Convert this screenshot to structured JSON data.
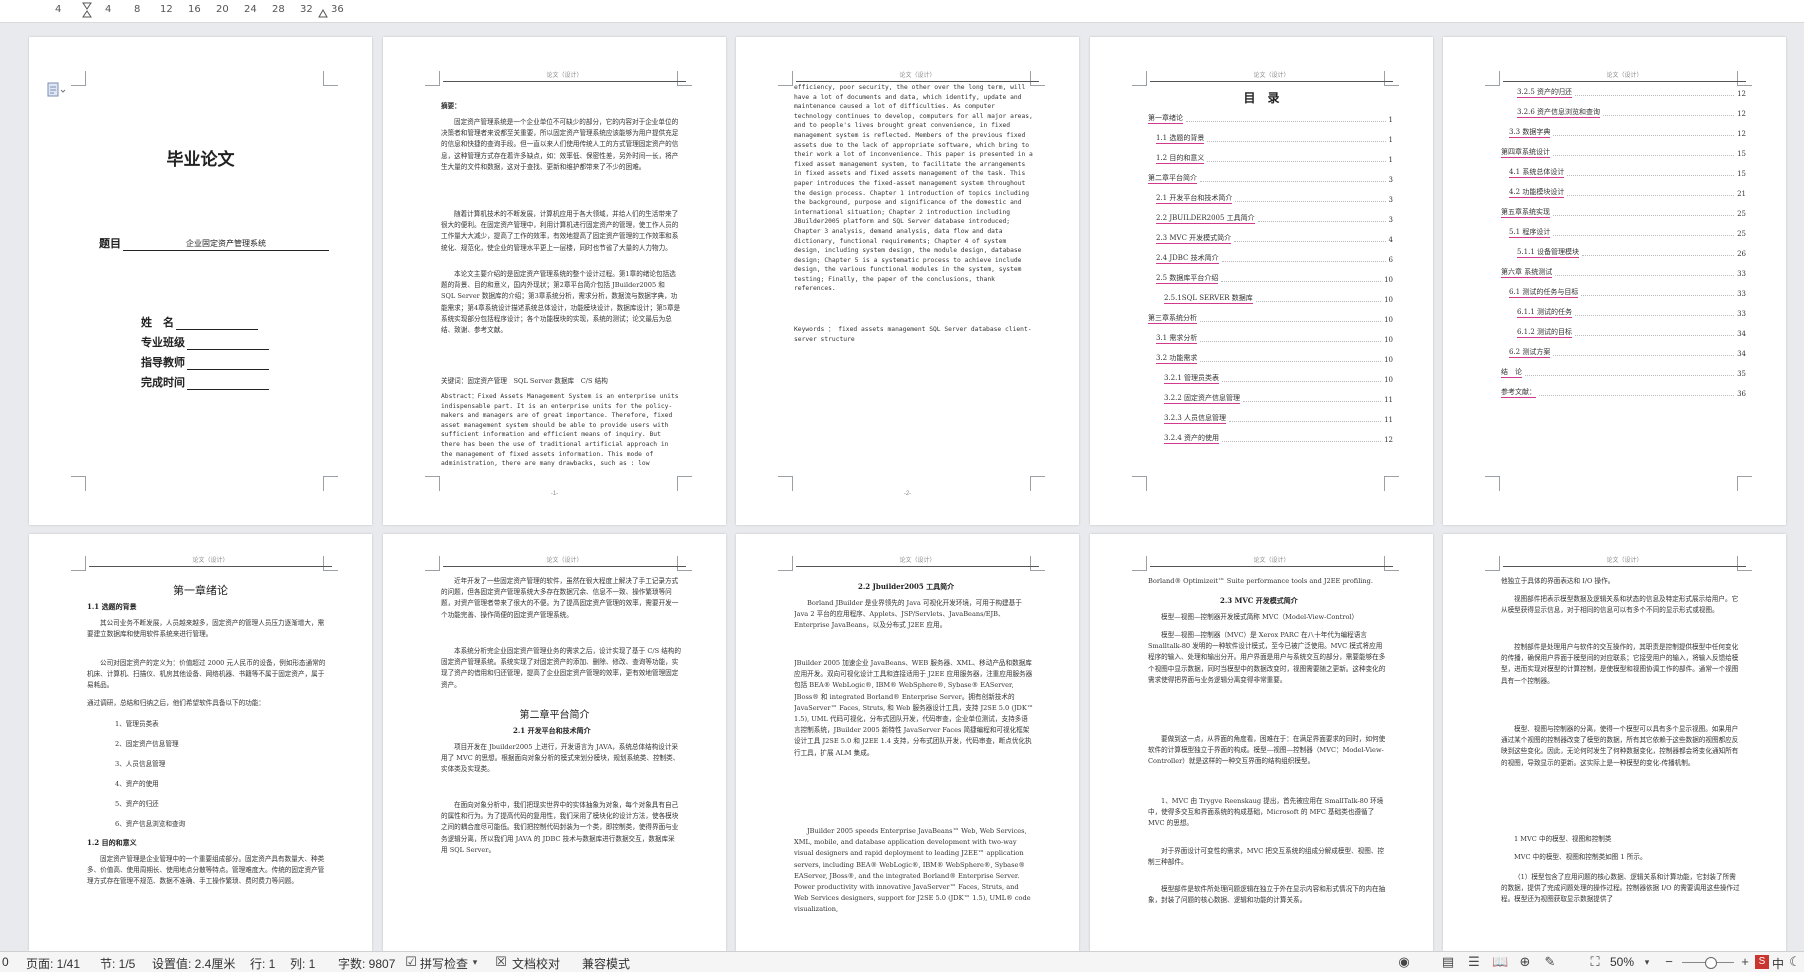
{
  "ruler": {
    "ticks": [
      "4",
      "4",
      "8",
      "12",
      "16",
      "20",
      "24",
      "28",
      "32",
      "36"
    ]
  },
  "pages": {
    "cover": {
      "title": "毕业论文",
      "topic_label": "题目",
      "topic_value": "企业固定资产管理系统",
      "fields": [
        "姓　名",
        "专业班级",
        "指导教师",
        "完成时间"
      ]
    },
    "abstract_cn": {
      "header": "论文（设计）",
      "heading": "摘要：",
      "p1": "固定资产管理系统是一个企业单位不可缺少的部分，它的内容对于企业单位的决策者和管理者来说都至关重要，所以固定资产管理系统应该能够为用户提供充足的信息和快捷的查询手段。但一直以来人们使用传统人工的方式管理固定资产的信息，这种管理方式存在着许多缺点，如：效率低、保密性差，另外时间一长，将产生大量的文件和数据，这对于查找、更新和维护都带来了不少的困难。",
      "p2": "随着计算机技术的不断发展，计算机应用于各大领域，并给人们的生活带来了很大的便利。在固定资产管理中，利用计算机进行固定资产的管理，使工作人员的工作量大大减少，提高了工作的效率，有效地提高了固定资产管理的工作效率和系统化、规范化，使企业的管理水平更上一层楼，同时也节省了大量的人力物力。",
      "p3": "本论文主要介绍的是固定资产管理系统的整个设计过程。第1章的绪论包括选题的背景、目的和意义，国内外现状；第2章平台简介包括 JBuilder2005 和 SQL Server 数据库的介绍；第3章系统分析，需求分析，数据流与数据字典，功能需求；第4章系统设计描述系统总体设计，功能模块设计，数据库设计；第5章是系统实现部分包括程序设计；各个功能模块的实现，系统的测试；论文最后为总结、致谢、参考文献。",
      "keywords": "关键词：固定资产管理　SQL Server 数据库　C/S 结构",
      "abstract_en": "Abstract：Fixed Assets Management System is an enterprise units indispensable part. It is an enterprise units for the policy-makers and managers are of great importance. Therefore, fixed asset management system should be able to provide users with sufficient information and efficient means of inquiry. But there has been the use of traditional artificial approach in the management of fixed assets information. This mode of administration, there are many drawbacks, such as : low",
      "footer": "-1-"
    },
    "abstract_en": {
      "header": "论文（设计）",
      "text": "efficiency, poor security, the other over the long term, will have a lot of documents and data, which identify, update and maintenance caused a lot of difficulties. As computer technology continues to develop, computers for all major areas, and to people's lives brought great convenience, in fixed management system is reflected. Members of the previous fixed assets due to the lack of appropriate software, which bring to their work a lot of inconvenience. This paper is presented in a fixed asset management system, to facilitate the arrangements in fixed assets and fixed assets management of the task. This paper introduces the fixed-asset management system throughout the design process. Chapter 1 introduction of topics including the background, purpose and significance of the domestic and international situation; Chapter 2 introduction including JBuilder2005 platform and SQL Server database introduced; Chapter 3 analysis, demand analysis, data flow and data dictionary, functional requirements; Chapter 4 of system design, including system design, the module design, database design; Chapter 5 is a systematic process to achieve include design, the various functional modules in the system, system testing; Finally, the paper of the conclusions, thank references.",
      "keywords": "Keywords ： fixed assets management SQL Server database client-server structure",
      "footer": "-2-"
    },
    "toc1": {
      "header": "论文（设计）",
      "title": "目　录",
      "items": [
        {
          "label": "第一章绪论",
          "page": "1"
        },
        {
          "label": "1.1 选题的背景",
          "page": "1"
        },
        {
          "label": "1.2 目的和意义",
          "page": "1"
        },
        {
          "label": "第二章平台简介",
          "page": "3"
        },
        {
          "label": "2.1 开发平台和技术简介",
          "page": "3"
        },
        {
          "label": "2.2 JBUILDER2005 工具简介",
          "page": "3"
        },
        {
          "label": "2.3 MVC 开发模式简介",
          "page": "4"
        },
        {
          "label": "2.4 JDBC 技术简介",
          "page": "6"
        },
        {
          "label": "2.5 数据库平台介绍",
          "page": "10"
        },
        {
          "label": "2.5.1SQL SERVER 数据库",
          "page": "10"
        },
        {
          "label": "第三章系统分析",
          "page": "10"
        },
        {
          "label": "3.1 需求分析",
          "page": "10"
        },
        {
          "label": "3.2 功能需求",
          "page": "10"
        },
        {
          "label": "3.2.1 管理员类表",
          "page": "10"
        },
        {
          "label": "3.2.2 固定资产信息管理",
          "page": "11"
        },
        {
          "label": "3.2.3 人员信息管理",
          "page": "11"
        },
        {
          "label": "3.2.4 资产的使用",
          "page": "12"
        }
      ]
    },
    "toc2": {
      "header": "论文（设计）",
      "items": [
        {
          "label": "3.2.5 资产的归还",
          "page": "12"
        },
        {
          "label": "3.2.6 资产信息浏览和查询",
          "page": "12"
        },
        {
          "label": "3.3 数据字典",
          "page": "12"
        },
        {
          "label": "第四章系统设计",
          "page": "15"
        },
        {
          "label": "4.1 系统总体设计",
          "page": "15"
        },
        {
          "label": "4.2 功能模块设计",
          "page": "21"
        },
        {
          "label": "第五章系统实现",
          "page": "25"
        },
        {
          "label": "5.1 程序设计",
          "page": "25"
        },
        {
          "label": "5.1.1 设备管理模块",
          "page": "26"
        },
        {
          "label": "第六章 系统测试",
          "page": "33"
        },
        {
          "label": "6.1 测试的任务与目标",
          "page": "33"
        },
        {
          "label": "6.1.1 测试的任务",
          "page": "33"
        },
        {
          "label": "6.1.2 测试的目标",
          "page": "34"
        },
        {
          "label": "6.2 测试方案",
          "page": "34"
        },
        {
          "label": "结　论",
          "page": "35"
        },
        {
          "label": "参考文献：",
          "page": "36"
        }
      ]
    },
    "ch1": {
      "header": "论文（设计）",
      "title": "第一章绪论",
      "s1": "1.1 选题的背景",
      "p1": "其公司业务不断发展，人员越来越多，固定资产的管理人员压力逐渐增大，需要建立数据库和使用软件系统来进行管理。",
      "p2": "公司对固定资产的定义为：价值超过 2000 元人民币的设备，例如形态通常的机床、计算机、扫描仪、机房其他设备、网络机器、书籍等不属于固定资产，属于易耗品。",
      "p3": "通过调研，总结和归纳之后，他们希望软件具备以下的功能：",
      "list": [
        "1、管理员类表",
        "2、固定资产信息管理",
        "3、人员信息管理",
        "4、资产的使用",
        "5、资产的归还",
        "6、资产信息浏览和查询"
      ],
      "s2": "1.2 目的和意义",
      "p4": "固定资产管理是企业管理中的一个重要组成部分。固定资产具有数量大、种类多、价值高、使用周期长、使用地点分散等特点。管理难度大。传统的固定资产管理方式存在管理不规范、数据不准确、手工操作繁琐、费时费力等问题。"
    },
    "ch2a": {
      "header": "论文（设计）",
      "p1": "近年开发了一些固定资产管理的软件，虽然在很大程度上解决了手工记录方式的问题，但各固定资产管理系统大多存在数据冗余、信息不一致、操作繁琐等问题，对资产管理者带来了很大的不便。为了提高固定资产管理的效率，需要开发一个功能完善、操作简便的固定资产管理系统。",
      "p2": "本系统分析完企业固定资产管理业务的需求之后，设计实现了基于 C/S 结构的固定资产管理系统。系统实现了对固定资产的添加、删除、修改、查询等功能，实现了资产的借用和归还管理，提高了企业固定资产管理的效率，更有效地管理固定资产。",
      "title": "第二章平台简介",
      "s1": "2.1 开发平台和技术简介",
      "p3": "项目开发在 Jbuilder2005 上进行，开发语言为 JAVA，系统总体结构设计采用了 MVC 的思想。根据面向对象分析的模式来划分模块，规划系统类、控制类、实体类及实现类。",
      "p4": "在面向对象分析中，我们把现实世界中的实体抽象为对象，每个对象具有自己的属性和行为。为了提高代码的复用性，我们采用了模块化的设计方法，使各模块之间的耦合度尽可能低。我们把控制代码封装为一个类，即控制类，使得界面与业务逻辑分离，所以我们用 JAVA 的 JDBC 技术与数据库进行数据交互，数据库采用 SQL Server。"
    },
    "ch2b": {
      "header": "论文（设计）",
      "s1": "2.2 Jbuilder2005 工具简介",
      "p1": "Borland JBuilder 是业界领先的 Java 可视化开发环境，可用于构建基于 Java 2 平台的应用程序、Applets、JSP/Servlets、JavaBeans/EJB、Enterprise JavaBeans，以及分布式 J2EE 应用。",
      "p2": "JBuilder 2005 加速企业 JavaBeans、WEB 服务器、XML、移动产品和数据库应用开发。双向可视化设计工具和连接适用于 J2EE 应用服务器，注重应用服务器包括 BEA® WebLogic®, IBM® WebSphere®, Sybase® EAServer, JBoss® 和 integrated Borland® Enterprise Server。拥有创新技术的 JavaServer™ Faces, Struts, 和 Web 服务器设计工具，支持 J2SE 5.0 (JDK™ 1.5), UML 代码可视化，分布式团队开发，代码审查，企业单位测试，支持多语言控制系统，JBuilder 2005 新特性 JavaServer Faces 简捷编程和可视化框架设计工具 J2SE 5.0 和 J2EE 1.4 支持，分布式团队开发，代码审查，断点优化执行工具，扩展 ALM 集成。",
      "p3": "JBuilder 2005 speeds Enterprise JavaBeans™ Web, Web Services, XML, mobile, and database application development with two-way visual designers and rapid deployment to leading J2EE™ application servers, including BEA® WebLogic®, IBM® WebSphere®, Sybase® EAServer, JBoss®, and the integrated Borland® Enterprise Server. Power productivity with innovative JavaServer™ Faces, Struts, and Web Services designers, support for J2SE 5.0 (JDK™ 1.5), UML® code visualization,"
    },
    "ch2c": {
      "header": "论文（设计）",
      "p0": "Borland® Optimizeit™ Suite performance tools and J2EE profiling.",
      "s1": "2.3 MVC 开发模式简介",
      "p1": "模型—视图—控制器开发模式简称 MVC（Model-View-Control）",
      "p2": "模型—视图—控制器（MVC）是 Xerox PARC 在八十年代为编程语言 Smalltalk-80 发明的一种软件设计模式，至今已被广泛使用。MVC 模式将应用程序的输入、处理和输出分开。用户界面是用户与系统交互的部分，需要能够在多个视图中显示数据，同时当模型中的数据改变时，视图需要随之更新。这种变化的需求使得把界面与业务逻辑分离变得非常重要。",
      "p3": "要做到这一点，从界面的角度看，困难在于：在满足界面要求的同时，如何使软件的计算模型独立于界面的构成。模型—视图—控制器（MVC：Model-View-Controller）就是这样的一种交互界面的结构组织模型。",
      "p4": "1、MVC 由 Trygve Reenskaug 提出，首先被应用在 SmallTalk-80 环境中，使得多交互和界面系统的构成基础，Microsoft 的 MFC 基础类也遵循了 MVC 的思想。",
      "p5": "对于界面设计可变性的需求，MVC 把交互系统的组成分解成模型、视图、控制三种部件。",
      "p6": "模型部件是软件所处理问题逻辑在独立于外在显示内容和形式情况下的内在抽象，封装了问题的核心数据、逻辑和功能的计算关系。"
    },
    "ch2d": {
      "header": "论文（设计）",
      "p1": "他独立于具体的界面表达和 I/O 操作。",
      "p2": "视图部件把表示模型数据及逻辑关系和状态的信息及特定形式展示给用户。它从模型获得显示信息，对于相同的信息可以有多个不同的显示形式或视图。",
      "p3": "控制部件是处理用户与软件的交互操作的，其职责是控制提供模型中任何变化的传播，确保用户界面于模型间的对应联系；它接受用户的输入，将输入反馈给模型，进而实现对模型的计算控制，是使模型和视图协调工作的部件。通常一个视图具有一个控制器。",
      "p4": "模型、视图与控制器的分离，使得一个模型可以具有多个显示视图。如果用户通过某个视图的控制器改变了模型的数据，所有其它依赖于这些数据的视图都应反映到这些变化。因此，无论何时发生了何种数据变化，控制器都会将变化通知所有的视图，导致显示的更新。这实际上是一种模型的变化-传播机制。",
      "p5": "1 MVC 中的模型、视图和控制类",
      "p6": "MVC 中的模型、视图和控制类如图 1 所示。",
      "p7": "（1）模型包含了应用问题的核心数据、逻辑关系和计算功能，它封装了所需的数据，提供了完成问题处理的操作过程。控制器依据 I/O 的需要调用这些操作过程。模型还为视图获取显示数据提供了"
    }
  },
  "statusbar": {
    "col0": "0",
    "page": "页面: 1/41",
    "section": "节: 1/5",
    "setting": "设置值: 2.4厘米",
    "row": "行: 1",
    "col": "列: 1",
    "words": "字数: 9807",
    "spell": "拼写检查",
    "doccheck": "文档校对",
    "compat": "兼容模式",
    "zoom": "50%",
    "ime": "中"
  }
}
